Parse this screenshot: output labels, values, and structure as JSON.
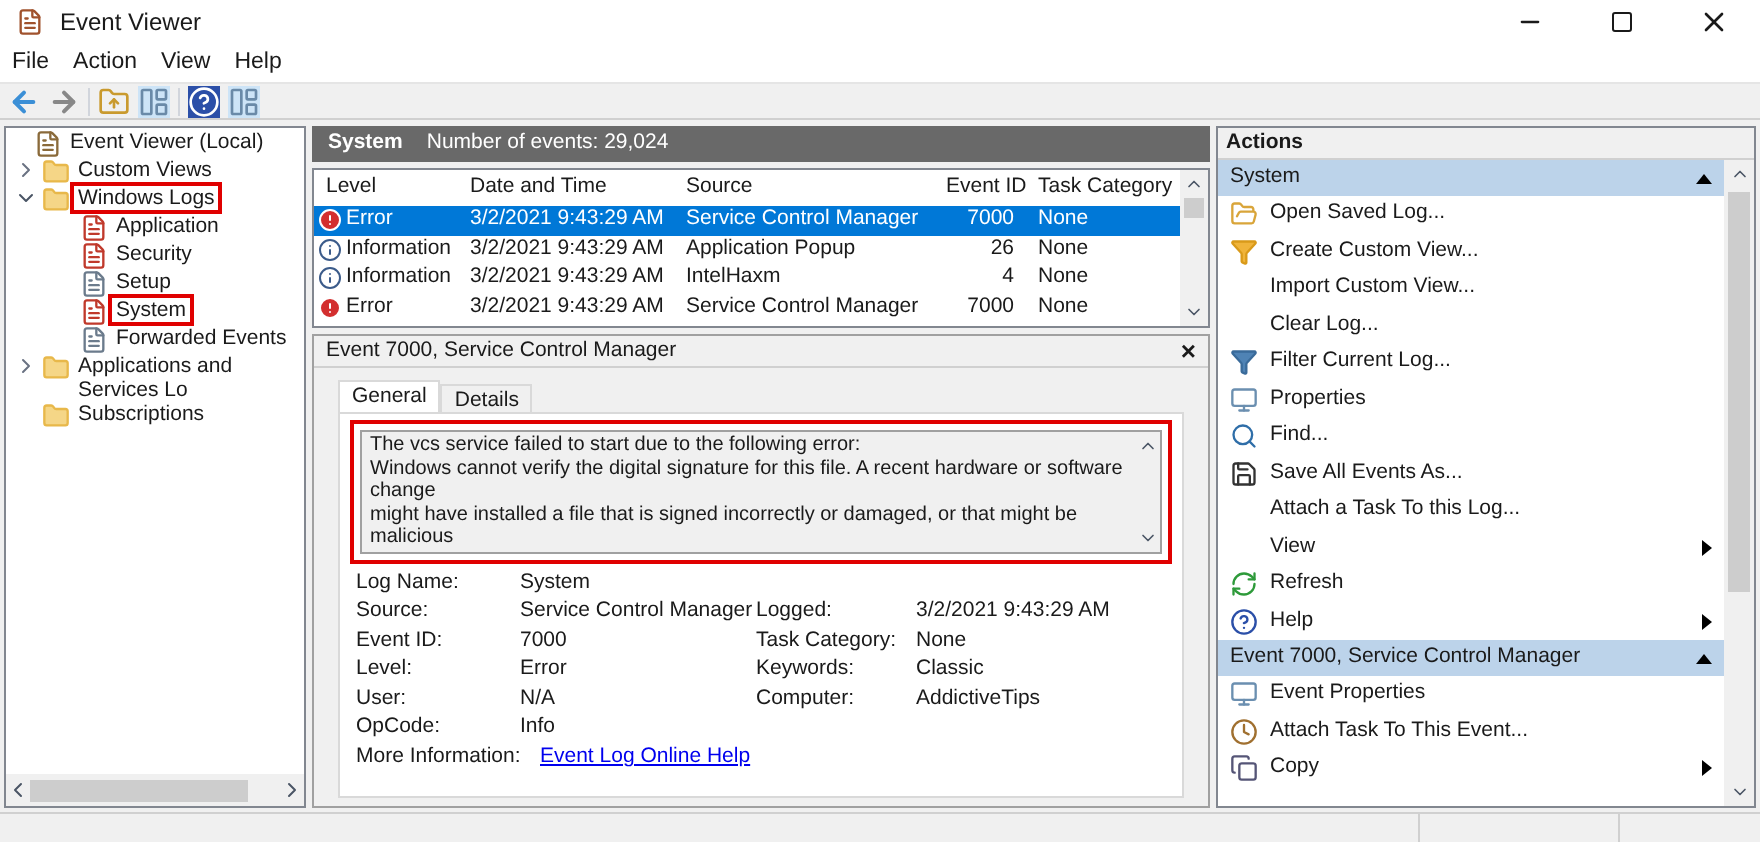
{
  "window": {
    "title": "Event Viewer"
  },
  "menu": [
    "File",
    "Action",
    "View",
    "Help"
  ],
  "tree": [
    {
      "label": "Event Viewer (Local)",
      "kind": "root",
      "highlighted": false,
      "children": [
        {
          "label": "Custom Views",
          "kind": "folder",
          "expanded": false,
          "highlighted": false
        },
        {
          "label": "Windows Logs",
          "kind": "folder",
          "expanded": true,
          "highlighted": true,
          "children": [
            {
              "label": "Application",
              "kind": "log",
              "highlighted": false
            },
            {
              "label": "Security",
              "kind": "log",
              "highlighted": false
            },
            {
              "label": "Setup",
              "kind": "plainlog",
              "highlighted": false
            },
            {
              "label": "System",
              "kind": "log",
              "highlighted": true
            },
            {
              "label": "Forwarded Events",
              "kind": "plainlog",
              "highlighted": false
            }
          ]
        },
        {
          "label": "Applications and Services Lo",
          "kind": "folder",
          "expanded": false,
          "highlighted": false
        },
        {
          "label": "Subscriptions",
          "kind": "folder",
          "highlighted": false
        }
      ]
    }
  ],
  "log_header": {
    "name": "System",
    "count": "Number of events: 29,024"
  },
  "table": {
    "columns": [
      "Level",
      "Date and Time",
      "Source",
      "Event ID",
      "Task Category"
    ],
    "rows": [
      {
        "level": "Error",
        "kind": "error",
        "date": "3/2/2021 9:43:29 AM",
        "source": "Service Control Manager",
        "event_id": "7000",
        "category": "None",
        "selected": true
      },
      {
        "level": "Information",
        "kind": "info",
        "date": "3/2/2021 9:43:29 AM",
        "source": "Application Popup",
        "event_id": "26",
        "category": "None",
        "selected": false
      },
      {
        "level": "Information",
        "kind": "info",
        "date": "3/2/2021 9:43:29 AM",
        "source": "IntelHaxm",
        "event_id": "4",
        "category": "None",
        "selected": false
      },
      {
        "level": "Error",
        "kind": "error",
        "date": "3/2/2021 9:43:29 AM",
        "source": "Service Control Manager",
        "event_id": "7000",
        "category": "None",
        "selected": false
      }
    ]
  },
  "detail": {
    "title": "Event 7000, Service Control Manager",
    "close": "×",
    "tabs": [
      {
        "label": "General",
        "selected": true
      },
      {
        "label": "Details",
        "selected": false
      }
    ],
    "description": {
      "highlighted": true,
      "lines": [
        "The vcs service failed to start due to the following error:",
        "Windows cannot verify the digital signature for this file. A recent hardware or software change",
        "might have installed a file that is signed incorrectly or damaged, or that might be malicious"
      ]
    },
    "fields_left": [
      {
        "label": "Log Name:",
        "value": "System"
      },
      {
        "label": "Source:",
        "value": "Service Control Manager"
      },
      {
        "label": "Event ID:",
        "value": "7000"
      },
      {
        "label": "Level:",
        "value": "Error"
      },
      {
        "label": "User:",
        "value": "N/A"
      },
      {
        "label": "OpCode:",
        "value": "Info"
      }
    ],
    "fields_right": [
      {
        "label": "Logged:",
        "value": "3/2/2021 9:43:29 AM"
      },
      {
        "label": "Task Category:",
        "value": "None"
      },
      {
        "label": "Keywords:",
        "value": "Classic"
      },
      {
        "label": "Computer:",
        "value": "AddictiveTips"
      }
    ],
    "more_info": {
      "label": "More Information:",
      "link": "Event Log Online Help"
    }
  },
  "actions": {
    "title": "Actions",
    "sections": [
      {
        "title": "System",
        "items": [
          {
            "label": "Open Saved Log...",
            "kind": "open",
            "submenu": false
          },
          {
            "label": "Create Custom View...",
            "kind": "custom-view",
            "submenu": false
          },
          {
            "label": "Import Custom View...",
            "kind": "plain",
            "submenu": false
          },
          {
            "label": "Clear Log...",
            "kind": "plain",
            "submenu": false
          },
          {
            "label": "Filter Current Log...",
            "kind": "filter",
            "submenu": false
          },
          {
            "label": "Properties",
            "kind": "properties",
            "submenu": false
          },
          {
            "label": "Find...",
            "kind": "find",
            "submenu": false
          },
          {
            "label": "Save All Events As...",
            "kind": "save",
            "submenu": false
          },
          {
            "label": "Attach a Task To this Log...",
            "kind": "plain",
            "submenu": false
          },
          {
            "label": "View",
            "kind": "plain",
            "submenu": true
          },
          {
            "label": "Refresh",
            "kind": "refresh",
            "submenu": false
          },
          {
            "label": "Help",
            "kind": "help",
            "submenu": true
          }
        ]
      },
      {
        "title": "Event 7000, Service Control Manager",
        "items": [
          {
            "label": "Event Properties",
            "kind": "properties",
            "submenu": false
          },
          {
            "label": "Attach Task To This Event...",
            "kind": "task",
            "submenu": false
          },
          {
            "label": "Copy",
            "kind": "copy",
            "submenu": true
          }
        ]
      }
    ]
  }
}
